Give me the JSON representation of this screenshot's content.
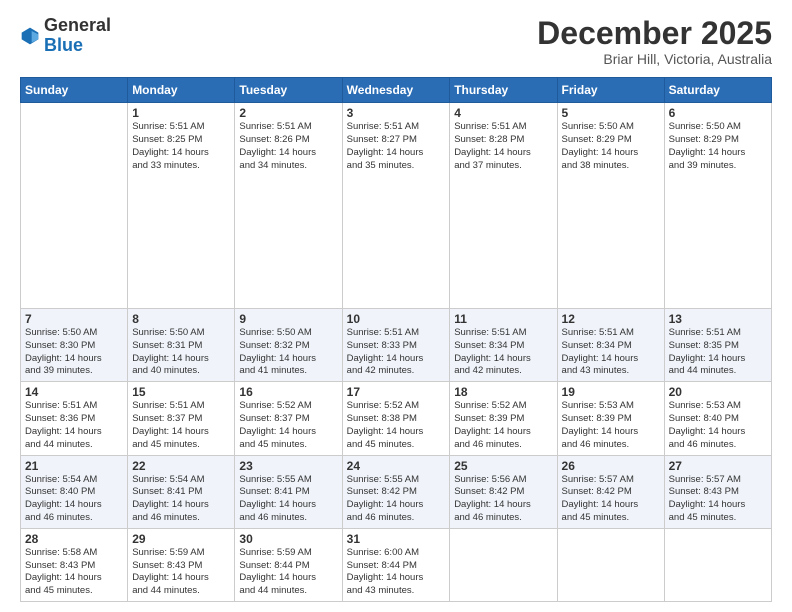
{
  "header": {
    "logo_general": "General",
    "logo_blue": "Blue",
    "month": "December 2025",
    "location": "Briar Hill, Victoria, Australia"
  },
  "days_of_week": [
    "Sunday",
    "Monday",
    "Tuesday",
    "Wednesday",
    "Thursday",
    "Friday",
    "Saturday"
  ],
  "weeks": [
    [
      {
        "day": "",
        "info": ""
      },
      {
        "day": "1",
        "info": "Sunrise: 5:51 AM\nSunset: 8:25 PM\nDaylight: 14 hours\nand 33 minutes."
      },
      {
        "day": "2",
        "info": "Sunrise: 5:51 AM\nSunset: 8:26 PM\nDaylight: 14 hours\nand 34 minutes."
      },
      {
        "day": "3",
        "info": "Sunrise: 5:51 AM\nSunset: 8:27 PM\nDaylight: 14 hours\nand 35 minutes."
      },
      {
        "day": "4",
        "info": "Sunrise: 5:51 AM\nSunset: 8:28 PM\nDaylight: 14 hours\nand 37 minutes."
      },
      {
        "day": "5",
        "info": "Sunrise: 5:50 AM\nSunset: 8:29 PM\nDaylight: 14 hours\nand 38 minutes."
      },
      {
        "day": "6",
        "info": "Sunrise: 5:50 AM\nSunset: 8:29 PM\nDaylight: 14 hours\nand 39 minutes."
      }
    ],
    [
      {
        "day": "7",
        "info": "Sunrise: 5:50 AM\nSunset: 8:30 PM\nDaylight: 14 hours\nand 39 minutes."
      },
      {
        "day": "8",
        "info": "Sunrise: 5:50 AM\nSunset: 8:31 PM\nDaylight: 14 hours\nand 40 minutes."
      },
      {
        "day": "9",
        "info": "Sunrise: 5:50 AM\nSunset: 8:32 PM\nDaylight: 14 hours\nand 41 minutes."
      },
      {
        "day": "10",
        "info": "Sunrise: 5:51 AM\nSunset: 8:33 PM\nDaylight: 14 hours\nand 42 minutes."
      },
      {
        "day": "11",
        "info": "Sunrise: 5:51 AM\nSunset: 8:34 PM\nDaylight: 14 hours\nand 42 minutes."
      },
      {
        "day": "12",
        "info": "Sunrise: 5:51 AM\nSunset: 8:34 PM\nDaylight: 14 hours\nand 43 minutes."
      },
      {
        "day": "13",
        "info": "Sunrise: 5:51 AM\nSunset: 8:35 PM\nDaylight: 14 hours\nand 44 minutes."
      }
    ],
    [
      {
        "day": "14",
        "info": "Sunrise: 5:51 AM\nSunset: 8:36 PM\nDaylight: 14 hours\nand 44 minutes."
      },
      {
        "day": "15",
        "info": "Sunrise: 5:51 AM\nSunset: 8:37 PM\nDaylight: 14 hours\nand 45 minutes."
      },
      {
        "day": "16",
        "info": "Sunrise: 5:52 AM\nSunset: 8:37 PM\nDaylight: 14 hours\nand 45 minutes."
      },
      {
        "day": "17",
        "info": "Sunrise: 5:52 AM\nSunset: 8:38 PM\nDaylight: 14 hours\nand 45 minutes."
      },
      {
        "day": "18",
        "info": "Sunrise: 5:52 AM\nSunset: 8:39 PM\nDaylight: 14 hours\nand 46 minutes."
      },
      {
        "day": "19",
        "info": "Sunrise: 5:53 AM\nSunset: 8:39 PM\nDaylight: 14 hours\nand 46 minutes."
      },
      {
        "day": "20",
        "info": "Sunrise: 5:53 AM\nSunset: 8:40 PM\nDaylight: 14 hours\nand 46 minutes."
      }
    ],
    [
      {
        "day": "21",
        "info": "Sunrise: 5:54 AM\nSunset: 8:40 PM\nDaylight: 14 hours\nand 46 minutes."
      },
      {
        "day": "22",
        "info": "Sunrise: 5:54 AM\nSunset: 8:41 PM\nDaylight: 14 hours\nand 46 minutes."
      },
      {
        "day": "23",
        "info": "Sunrise: 5:55 AM\nSunset: 8:41 PM\nDaylight: 14 hours\nand 46 minutes."
      },
      {
        "day": "24",
        "info": "Sunrise: 5:55 AM\nSunset: 8:42 PM\nDaylight: 14 hours\nand 46 minutes."
      },
      {
        "day": "25",
        "info": "Sunrise: 5:56 AM\nSunset: 8:42 PM\nDaylight: 14 hours\nand 46 minutes."
      },
      {
        "day": "26",
        "info": "Sunrise: 5:57 AM\nSunset: 8:42 PM\nDaylight: 14 hours\nand 45 minutes."
      },
      {
        "day": "27",
        "info": "Sunrise: 5:57 AM\nSunset: 8:43 PM\nDaylight: 14 hours\nand 45 minutes."
      }
    ],
    [
      {
        "day": "28",
        "info": "Sunrise: 5:58 AM\nSunset: 8:43 PM\nDaylight: 14 hours\nand 45 minutes."
      },
      {
        "day": "29",
        "info": "Sunrise: 5:59 AM\nSunset: 8:43 PM\nDaylight: 14 hours\nand 44 minutes."
      },
      {
        "day": "30",
        "info": "Sunrise: 5:59 AM\nSunset: 8:44 PM\nDaylight: 14 hours\nand 44 minutes."
      },
      {
        "day": "31",
        "info": "Sunrise: 6:00 AM\nSunset: 8:44 PM\nDaylight: 14 hours\nand 43 minutes."
      },
      {
        "day": "",
        "info": ""
      },
      {
        "day": "",
        "info": ""
      },
      {
        "day": "",
        "info": ""
      }
    ]
  ]
}
